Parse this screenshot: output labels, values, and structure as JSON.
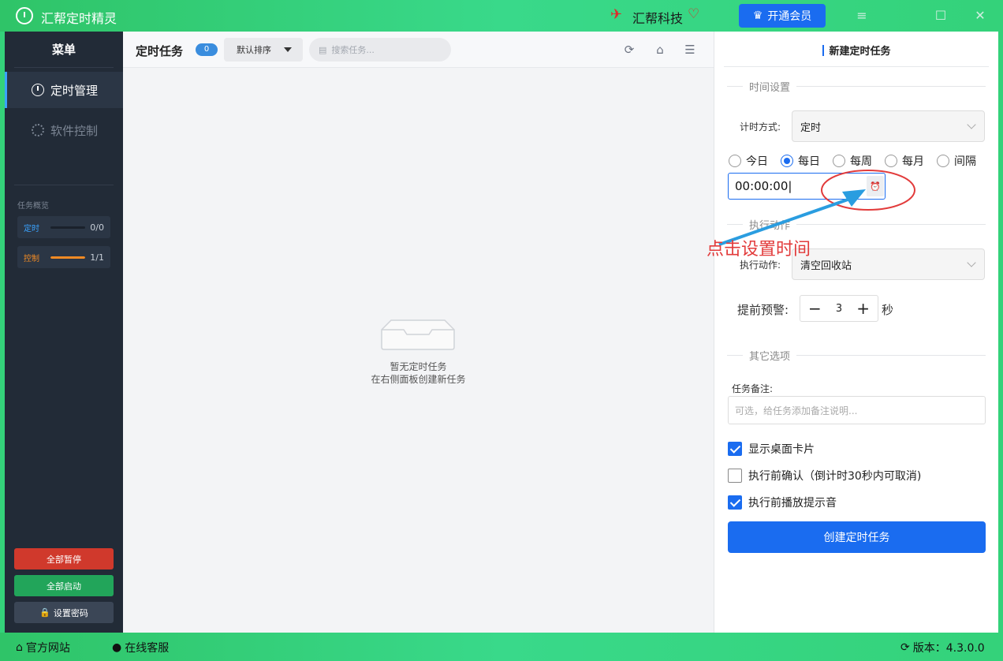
{
  "titlebar": {
    "app_title": "汇帮定时精灵",
    "brand_name": "汇帮科技",
    "vip_label": "开通会员"
  },
  "sidebar": {
    "menu_title": "菜单",
    "items": [
      {
        "label": "定时管理",
        "active": true
      },
      {
        "label": "软件控制",
        "active": false
      }
    ],
    "overview_label": "任务概览",
    "overview": [
      {
        "name": "定时",
        "count": "0/0",
        "progress": 0,
        "color": "#3aa3ff"
      },
      {
        "name": "控制",
        "count": "1/1",
        "progress": 1,
        "color": "#f08a24"
      }
    ],
    "buttons": {
      "pause_all": "全部暂停",
      "start_all": "全部启动",
      "set_password": "设置密码"
    }
  },
  "middle": {
    "title": "定时任务",
    "count": "0",
    "sort_label": "默认排序",
    "search_placeholder": "搜索任务...",
    "empty_line1": "暂无定时任务",
    "empty_line2": "在右侧面板创建新任务"
  },
  "panel": {
    "title": "新建定时任务",
    "section_time": "时间设置",
    "timing_mode_label": "计时方式:",
    "timing_mode_value": "定时",
    "radios": [
      {
        "label": "今日",
        "checked": false
      },
      {
        "label": "每日",
        "checked": true
      },
      {
        "label": "每周",
        "checked": false
      },
      {
        "label": "每月",
        "checked": false
      },
      {
        "label": "间隔",
        "checked": false
      }
    ],
    "time_value": "00:00:00",
    "section_action": "执行动作",
    "action_label": "执行动作:",
    "action_value": "清空回收站",
    "warn_label": "提前预警:",
    "warn_value": "3",
    "warn_unit": "秒",
    "section_other": "其它选项",
    "note_label": "任务备注:",
    "note_placeholder": "可选，给任务添加备注说明...",
    "checks": [
      {
        "label": "显示桌面卡片",
        "checked": true
      },
      {
        "label": "执行前确认（倒计时30秒内可取消)",
        "checked": false
      },
      {
        "label": "执行前播放提示音",
        "checked": true
      }
    ],
    "create_label": "创建定时任务"
  },
  "annotation": {
    "text": "点击设置时间"
  },
  "footer": {
    "website": "官方网站",
    "support": "在线客服",
    "version": "版本：4.3.0.0"
  }
}
